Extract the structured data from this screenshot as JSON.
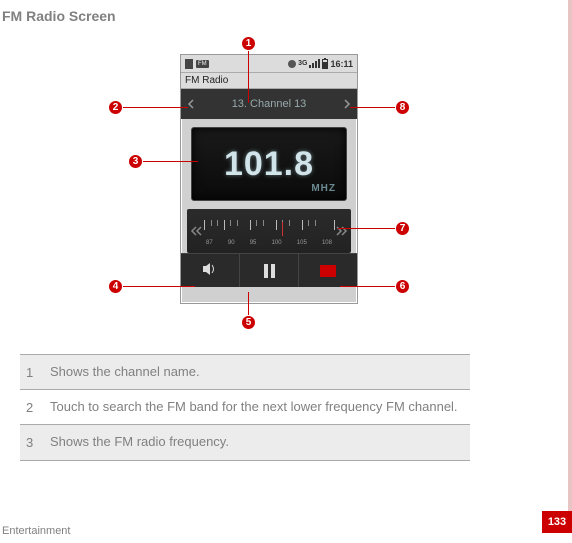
{
  "page": {
    "title": "FM Radio Screen",
    "footer": "Entertainment",
    "number": "133"
  },
  "phone": {
    "statusbar": {
      "fm_label": "FM",
      "threeg": "3G",
      "time": "16:11"
    },
    "app_title": "FM Radio",
    "channel_name": "13. Channel 13",
    "frequency": "101.8",
    "freq_unit": "MHZ",
    "dial_labels": [
      "87",
      "90",
      "95",
      "100",
      "105",
      "108"
    ]
  },
  "markers": {
    "m1": "1",
    "m2": "2",
    "m3": "3",
    "m4": "4",
    "m5": "5",
    "m6": "6",
    "m7": "7",
    "m8": "8"
  },
  "table": {
    "r1": {
      "num": "1",
      "text": "Shows the channel name."
    },
    "r2": {
      "num": "2",
      "text": "Touch to search the FM band for the next lower frequency FM channel."
    },
    "r3": {
      "num": "3",
      "text": "Shows the FM radio frequency."
    }
  }
}
